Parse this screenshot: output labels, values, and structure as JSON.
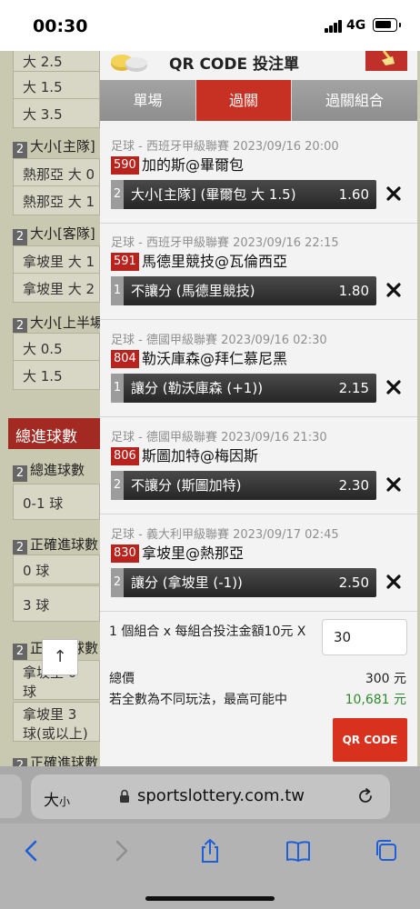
{
  "status_bar": {
    "time": "00:30",
    "network": "4G"
  },
  "background": {
    "rows_top": [
      "大 2.5",
      "大 1.5",
      "大 3.5"
    ],
    "sections": [
      {
        "num": "2",
        "label": "大小[主隊]",
        "rows": [
          "熱那亞 大 0",
          "熱那亞 大 1"
        ]
      },
      {
        "num": "2",
        "label": "大小[客隊]",
        "rows": [
          "拿坡里 大 1",
          "拿坡里 大 2"
        ]
      },
      {
        "num": "2",
        "label": "大小[上半場",
        "rows": [
          "大 0.5",
          "大 1.5"
        ]
      }
    ],
    "header": "總進球數",
    "sections2": [
      {
        "num": "2",
        "label": "總進球數",
        "rows": [
          "0-1 球"
        ]
      },
      {
        "num": "2",
        "label": "正確進球數",
        "rows": [
          "0 球",
          "3 球"
        ]
      },
      {
        "num": "2",
        "label": "正確進球數",
        "rows": [
          "拿坡里 0 球",
          "拿坡里 3 球(或以上)"
        ]
      },
      {
        "num": "2",
        "label": "正確進球數",
        "rows": []
      }
    ],
    "scroll_top": "↑"
  },
  "slip": {
    "title": "QR CODE 投注單",
    "tabs": [
      "單場",
      "過關",
      "過關組合"
    ],
    "active_tab": 1,
    "bets": [
      {
        "meta": "足球 - 西班牙甲級聯賽 2023/09/16 20:00",
        "code": "590",
        "match": "加的斯@畢爾包",
        "sel_num": "2",
        "selection": "大小[主隊] (畢爾包 大 1.5)",
        "odds": "1.60"
      },
      {
        "meta": "足球 - 西班牙甲級聯賽 2023/09/16 22:15",
        "code": "591",
        "match": "馬德里競技@瓦倫西亞",
        "sel_num": "1",
        "selection": "不讓分 (馬德里競技)",
        "odds": "1.80"
      },
      {
        "meta": "足球 - 德國甲級聯賽 2023/09/16 02:30",
        "code": "804",
        "match": "勒沃庫森@拜仁慕尼黑",
        "sel_num": "1",
        "selection": "讓分 (勒沃庫森 (+1))",
        "odds": "2.15"
      },
      {
        "meta": "足球 - 德國甲級聯賽 2023/09/16 21:30",
        "code": "806",
        "match": "斯圖加特@梅因斯",
        "sel_num": "2",
        "selection": "不讓分 (斯圖加特)",
        "odds": "2.30"
      },
      {
        "meta": "足球 - 義大利甲級聯賽 2023/09/17 02:45",
        "code": "830",
        "match": "拿坡里@熱那亞",
        "sel_num": "2",
        "selection": "讓分 (拿坡里 (-1))",
        "odds": "2.50"
      }
    ],
    "combo_text": "1 個組合 x 每組合投注金額10元 X",
    "amount": "30",
    "total_label": "總價",
    "total_value": "300 元",
    "maxwin_label": "若全數為不同玩法，最高可能中",
    "maxwin_value": "10,681 元",
    "qr_button": "QR CODE"
  },
  "browser": {
    "aa_label": "大",
    "aa_small": "小",
    "url": "sportslottery.com.tw"
  },
  "colors": {
    "accent_red": "#c63123",
    "win_green": "#2e8a2e"
  }
}
